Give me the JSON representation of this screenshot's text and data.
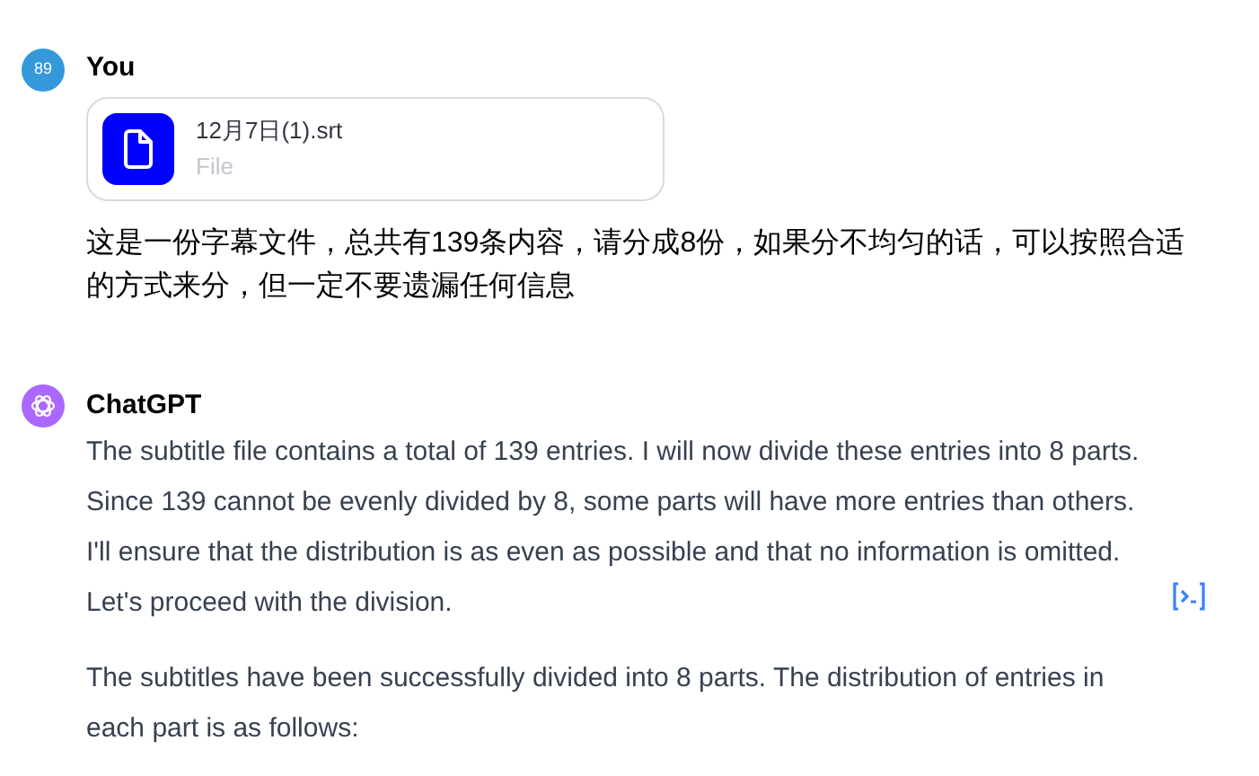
{
  "messages": [
    {
      "kind": "user",
      "avatar": "89",
      "author": "You",
      "attachment": {
        "name": "12月7日(1).srt",
        "type": "File"
      },
      "paragraphs": [
        "这是一份字幕文件，总共有139条内容，请分成8份，如果分不均匀的话，可以按照合适的方式来分，但一定不要遗漏任何信息"
      ]
    },
    {
      "kind": "assistant",
      "author": "ChatGPT",
      "paragraphs": [
        {
          "text": "The subtitle file contains a total of 139 entries. I will now divide these entries into 8 parts. Since 139 cannot be evenly divided by 8, some parts will have more entries than others. I'll ensure that the distribution is as even as possible and that no information is omitted. Let's proceed with the division.",
          "code_run": true
        },
        {
          "text": "The subtitles have been successfully divided into 8 parts. The distribution of entries in each part is as follows:",
          "code_run": false
        }
      ]
    }
  ]
}
